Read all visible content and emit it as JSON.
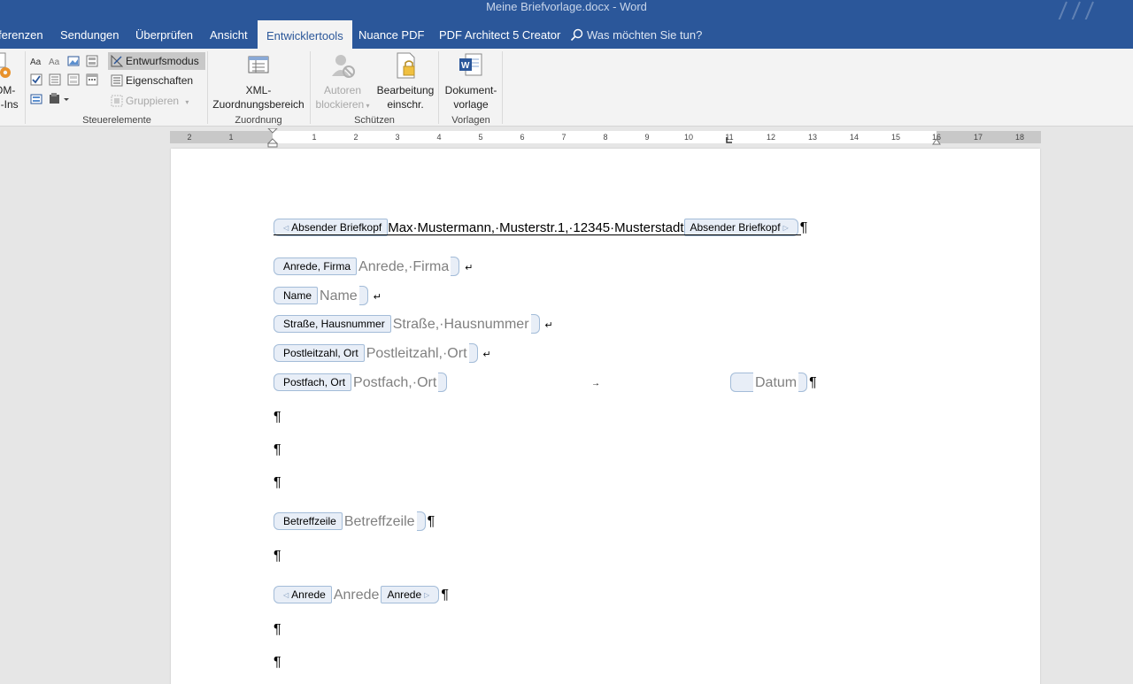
{
  "window": {
    "title": "Meine Briefvorlage.docx  -  Word"
  },
  "tabs": [
    {
      "label": "ferenzen"
    },
    {
      "label": "Sendungen"
    },
    {
      "label": "Überprüfen"
    },
    {
      "label": "Ansicht"
    },
    {
      "label": "Entwicklertools",
      "active": true
    },
    {
      "label": "Nuance PDF"
    },
    {
      "label": "PDF Architect 5 Creator"
    }
  ],
  "tell_me": {
    "placeholder": "Was möchten Sie tun?",
    "icon": "search-icon"
  },
  "ribbon": {
    "addins_partial": {
      "line1": "OM-",
      "line2": "d-Ins"
    },
    "controls": {
      "design_mode": "Entwurfsmodus",
      "properties": "Eigenschaften",
      "group": "Gruppieren",
      "group_label": "Steuerelemente"
    },
    "mapping": {
      "xml_line1": "XML-",
      "xml_line2": "Zuordnungsbereich",
      "group_label": "Zuordnung"
    },
    "protect": {
      "block_authors_line1": "Autoren",
      "block_authors_line2": "blockieren",
      "restrict_line1": "Bearbeitung",
      "restrict_line2": "einschr.",
      "group_label": "Schützen"
    },
    "templates": {
      "doc_template_line1": "Dokument-",
      "doc_template_line2": "vorlage",
      "group_label": "Vorlagen"
    }
  },
  "ruler": {
    "left_labels": [
      "2",
      "1"
    ],
    "labels": [
      "1",
      "2",
      "3",
      "4",
      "5",
      "6",
      "7",
      "8",
      "9",
      "10",
      "11",
      "12",
      "13",
      "14",
      "15",
      "16",
      "17",
      "18"
    ]
  },
  "document": {
    "sender_tag": "Absender Briefkopf",
    "sender_text": "Max·Mustermann,·Musterstr.1,·12345·Musterstadt",
    "fields": [
      {
        "tag": "Anrede, Firma",
        "placeholder": "Anrede,·Firma"
      },
      {
        "tag": "Name",
        "placeholder": "Name"
      },
      {
        "tag": "Straße, Hausnummer",
        "placeholder": "Straße,·Hausnummer"
      },
      {
        "tag": "Postleitzahl, Ort",
        "placeholder": "Postleitzahl,·Ort"
      },
      {
        "tag": "Postfach, Ort",
        "placeholder": "Postfach,·Ort"
      }
    ],
    "date_placeholder": "Datum",
    "subject_tag": "Betreffzeile",
    "subject_placeholder": "Betreffzeile",
    "salutation_tag": "Anrede",
    "salutation_placeholder": "Anrede",
    "pilcrow": "¶",
    "line_break": "↵",
    "tab_mark": "→"
  }
}
